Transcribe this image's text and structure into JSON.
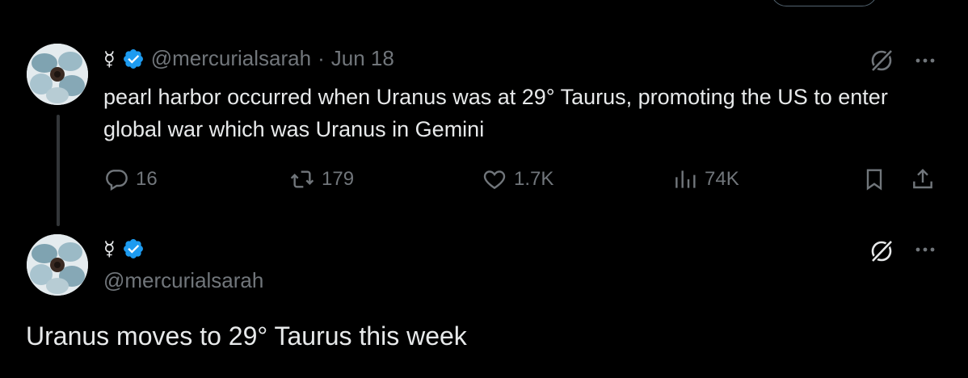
{
  "colors": {
    "background": "#000000",
    "text_primary": "#e7e9ea",
    "text_secondary": "#71767b",
    "verified_blue": "#1d9bf0",
    "thread_line": "#333639"
  },
  "reply_tweet": {
    "display_name": "☿",
    "handle": "@mercurialsarah",
    "separator": "·",
    "date": "Jun 18",
    "text": "pearl harbor occurred when Uranus was at 29° Taurus, promoting the US to enter global war which was Uranus in Gemini",
    "icons": [
      "grok-icon",
      "more-icon"
    ],
    "actions": {
      "replies": "16",
      "reposts": "179",
      "likes": "1.7K",
      "views": "74K"
    }
  },
  "main_tweet": {
    "display_name": "☿",
    "handle": "@mercurialsarah",
    "text": "Uranus moves to 29° Taurus this week",
    "icons": [
      "grok-icon",
      "more-icon"
    ]
  }
}
